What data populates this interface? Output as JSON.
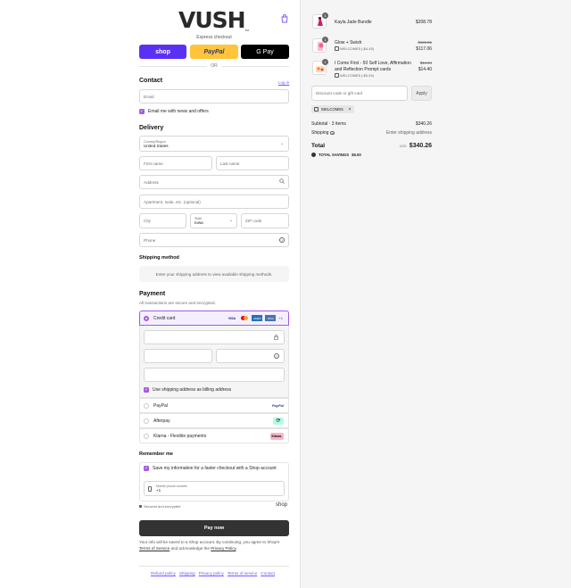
{
  "brand": {
    "logo": "VUSH",
    "tm": "TM"
  },
  "express": {
    "title": "Express checkout",
    "shop": "shop",
    "paypal": "PayPal",
    "gpay": "G Pay",
    "or": "OR"
  },
  "contact": {
    "title": "Contact",
    "login": "Log in",
    "email_placeholder": "Email",
    "news": "Email me with news and offers"
  },
  "delivery": {
    "title": "Delivery",
    "country_label": "Country/Region",
    "country": "United States",
    "first": "First name",
    "last": "Last name",
    "address": "Address",
    "apt": "Apartment, suite, etc. (optional)",
    "city": "City",
    "state_label": "State",
    "state": "Iowa",
    "zip": "ZIP code",
    "phone": "Phone"
  },
  "shipping": {
    "title": "Shipping method",
    "note": "Enter your shipping address to view available shipping methods."
  },
  "payment": {
    "title": "Payment",
    "sub": "All transactions are secure and encrypted.",
    "credit": "Credit card",
    "more": "+1",
    "billing": "Use shipping address as billing address",
    "paypal": "PayPal",
    "paypal_logo": "PayPal",
    "afterpay": "Afterpay",
    "afterpay_logo": "⟳",
    "klarna": "Klarna - Flexible payments",
    "klarna_logo": "Klarna.",
    "cards": [
      "VISA",
      "MC",
      "AMEX",
      "DISC"
    ]
  },
  "remember": {
    "title": "Remember me",
    "save": "Save my information for a faster checkout with a Shop account",
    "phone_label": "Mobile phone number",
    "phone_value": "+1",
    "secure": "Secured and encrypted",
    "shop": "shop"
  },
  "pay_button": "Pay now",
  "fine": {
    "text1": "Your info will be saved to a Shop account. By continuing, you agree to Shop's ",
    "terms": "Terms of Service",
    "text2": " and acknowledge the ",
    "privacy": "Privacy Policy",
    "text3": "."
  },
  "footer": [
    "Refund policy",
    "Shipping",
    "Privacy policy",
    "Terms of service",
    "Contact"
  ],
  "summary": {
    "items": [
      {
        "qty": "1",
        "name": "Kayla Jade Bundle",
        "discount": "",
        "orig": "",
        "price": "$208.78"
      },
      {
        "qty": "1",
        "name": "Glow + Swish",
        "discount": "WELCOME5 (-$4.45)",
        "orig": "$121.51",
        "price": "$117.06"
      },
      {
        "qty": "1",
        "name": "I Come First - 50 Self Love, Affirmation and Reflection Prompt cards",
        "discount": "WELCOME5 (-$0.54)",
        "orig": "$14.94",
        "price": "$14.40"
      }
    ],
    "discount_placeholder": "Discount code or gift card",
    "apply": "Apply",
    "code": "WELCOME5",
    "subtotal_label": "Subtotal · 3 items",
    "subtotal": "$340.26",
    "shipping_label": "Shipping",
    "shipping_value": "Enter shipping address",
    "total_label": "Total",
    "currency": "USD",
    "total": "$340.26",
    "savings_label": "TOTAL SAVINGS",
    "savings": "$5.00"
  }
}
